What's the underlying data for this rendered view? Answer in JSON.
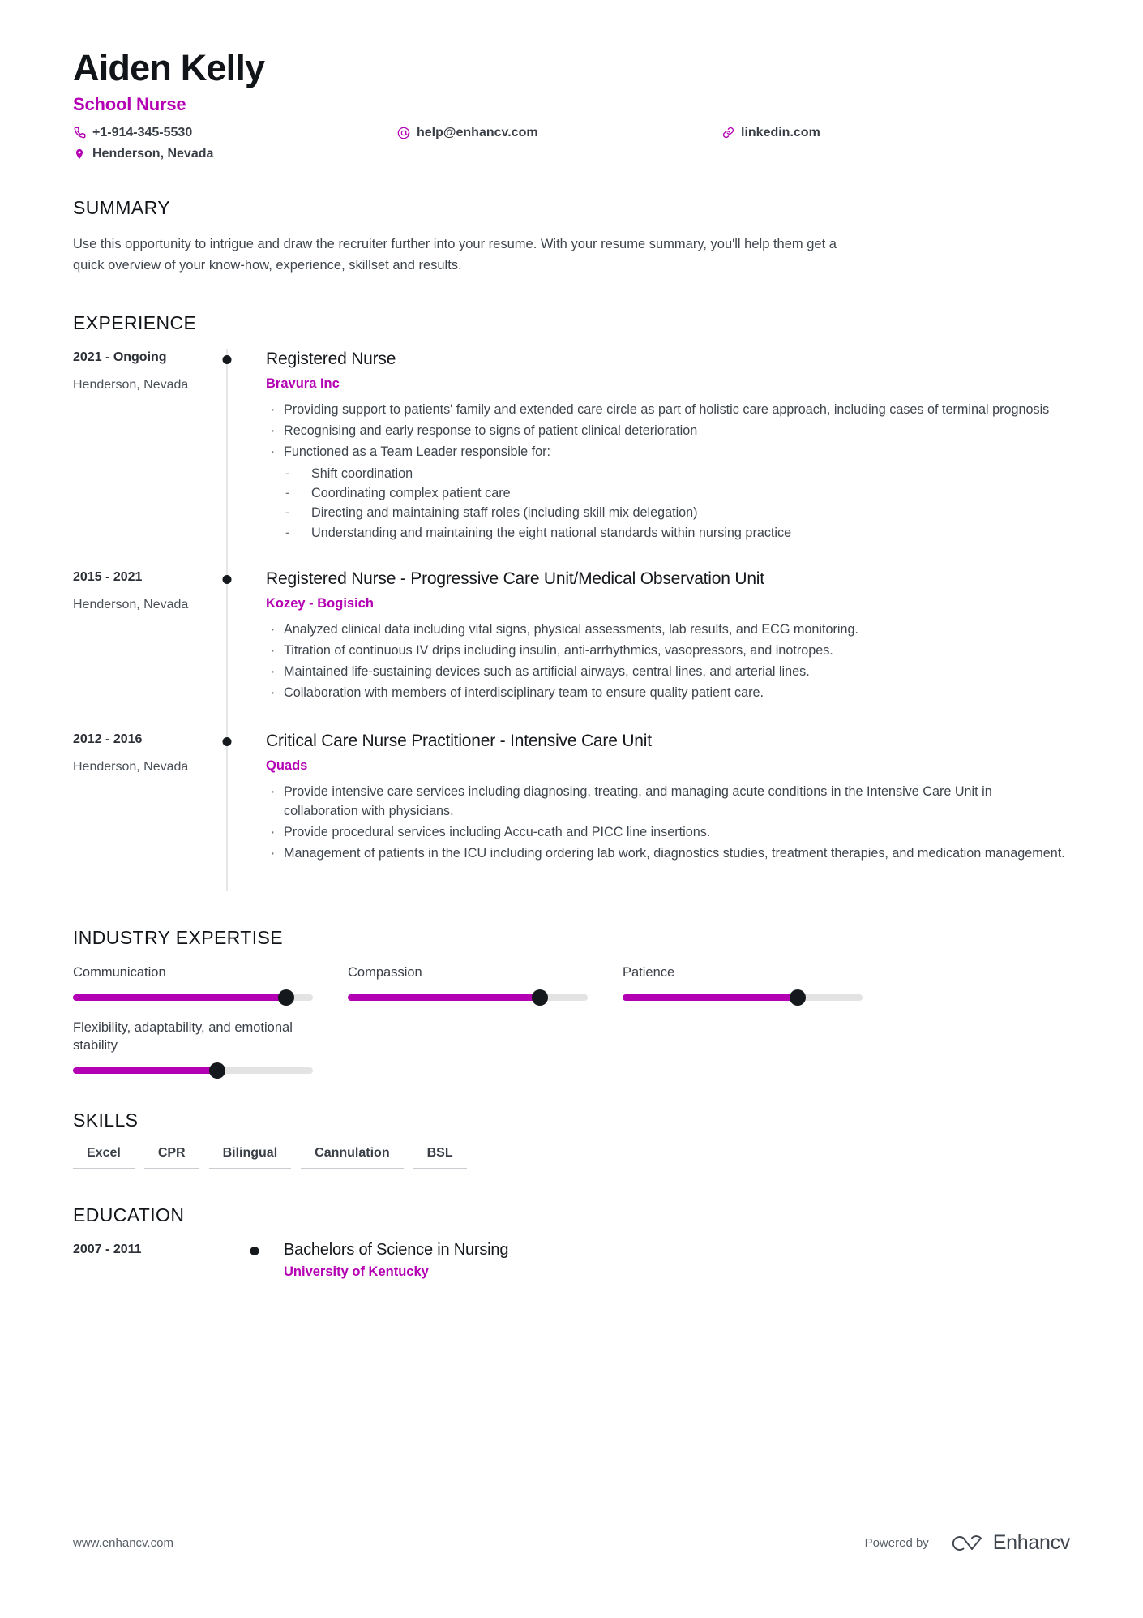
{
  "header": {
    "name": "Aiden Kelly",
    "title": "School Nurse",
    "contacts": [
      {
        "icon": "phone-icon",
        "text": "+1-914-345-5530"
      },
      {
        "icon": "email-icon",
        "text": "help@enhancv.com"
      },
      {
        "icon": "link-icon",
        "text": "linkedin.com"
      },
      {
        "icon": "location-icon",
        "text": "Henderson, Nevada"
      }
    ]
  },
  "summary": {
    "heading": "SUMMARY",
    "text": "Use this opportunity to intrigue and draw the recruiter further into your resume. With your resume summary, you'll help them get a quick overview of your know-how, experience, skillset and results."
  },
  "experience": {
    "heading": "EXPERIENCE",
    "items": [
      {
        "date": "2021 - Ongoing",
        "location": "Henderson, Nevada",
        "title": "Registered Nurse",
        "company": "Bravura Inc",
        "bullets": [
          "Providing support to patients' family and extended care circle as part of holistic care approach, including cases of terminal prognosis",
          "Recognising and early response to signs of patient clinical deterioration",
          "Functioned as a Team Leader responsible for:"
        ],
        "subbullets": [
          "Shift coordination",
          "Coordinating complex patient care",
          "Directing and maintaining staff roles (including skill mix delegation)",
          "Understanding and maintaining the eight national standards within nursing practice"
        ]
      },
      {
        "date": "2015 - 2021",
        "location": "Henderson, Nevada",
        "title": "Registered Nurse - Progressive Care Unit/Medical Observation Unit",
        "company": "Kozey - Bogisich",
        "bullets": [
          "Analyzed clinical data including vital signs, physical assessments, lab results, and ECG monitoring.",
          "Titration of continuous IV drips including insulin, anti-arrhythmics, vasopressors, and inotropes.",
          "Maintained life-sustaining devices such as artificial airways, central lines, and arterial lines.",
          "Collaboration with members of interdisciplinary team to ensure quality patient care."
        ],
        "subbullets": []
      },
      {
        "date": "2012 - 2016",
        "location": "Henderson, Nevada",
        "title": "Critical Care Nurse Practitioner - Intensive Care Unit",
        "company": "Quads",
        "bullets": [
          "Provide intensive care services including diagnosing, treating, and managing acute conditions in the Intensive Care Unit in collaboration with physicians.",
          "Provide procedural services including Accu-cath and PICC line insertions.",
          "Management of patients in the ICU including ordering lab work, diagnostics studies, treatment therapies, and medication management."
        ],
        "subbullets": []
      }
    ]
  },
  "industry_expertise": {
    "heading": "INDUSTRY EXPERTISE",
    "items": [
      {
        "label": "Communication",
        "value": 89
      },
      {
        "label": "Compassion",
        "value": 80
      },
      {
        "label": "Patience",
        "value": 73
      },
      {
        "label": "Flexibility, adaptability, and emotional stability",
        "value": 60
      }
    ]
  },
  "skills": {
    "heading": "SKILLS",
    "items": [
      "Excel",
      "CPR",
      "Bilingual",
      "Cannulation",
      "BSL"
    ]
  },
  "education": {
    "heading": "EDUCATION",
    "items": [
      {
        "date": "2007 - 2011",
        "degree": "Bachelors of Science in Nursing",
        "school": "University of Kentucky"
      }
    ]
  },
  "footer": {
    "url": "www.enhancv.com",
    "powered_by": "Powered by",
    "brand": "Enhancv"
  },
  "colors": {
    "accent": "#b300b3",
    "text": "#3f454d",
    "dark": "#15181c",
    "track": "#e3e3e3"
  }
}
